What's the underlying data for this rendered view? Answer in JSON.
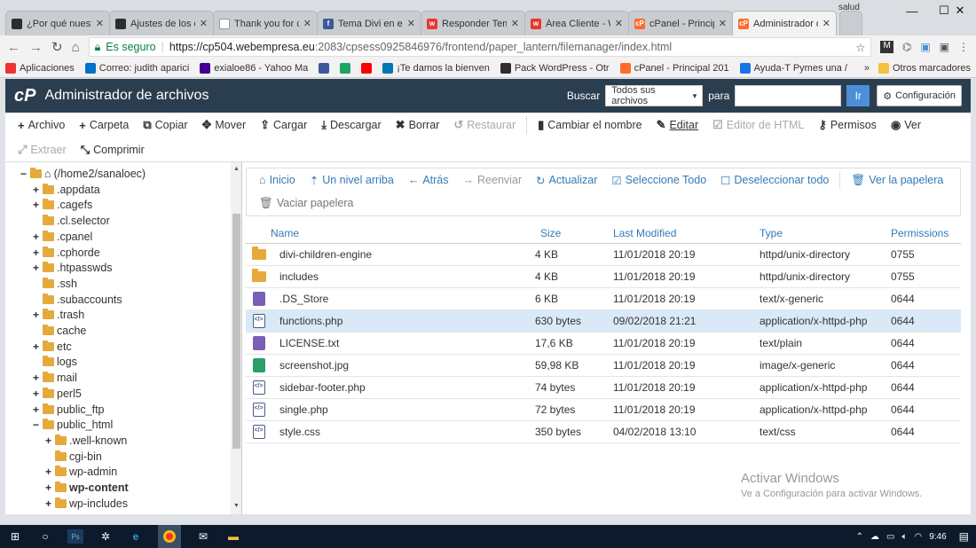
{
  "browser": {
    "profile": "salud",
    "tabs": [
      {
        "title": "¿Por qué nuestro",
        "icon_color": "#2d2d2d",
        "icon_text": ""
      },
      {
        "title": "Ajustes de los e",
        "icon_color": "#2d2d2d",
        "icon_text": ""
      },
      {
        "title": "Thank you for c",
        "icon_color": "#ffffff",
        "icon_text": ""
      },
      {
        "title": "Tema Divi en ex",
        "icon_color": "#3b5998",
        "icon_text": "f"
      },
      {
        "title": "Responder Tem",
        "icon_color": "#e8372c",
        "icon_text": "w"
      },
      {
        "title": "Área Cliente - W",
        "icon_color": "#e8372c",
        "icon_text": "w"
      },
      {
        "title": "cPanel - Princip",
        "icon_color": "#ff6c2c",
        "icon_text": "cP"
      },
      {
        "title": "Administrador d",
        "icon_color": "#ff6c2c",
        "icon_text": "cP"
      }
    ],
    "active_tab": 7,
    "url_secure_label": "Es seguro",
    "url_domain": "https://cp504.webempresa.eu",
    "url_path": ":2083/cpsess0925846976/frontend/paper_lantern/filemanager/index.html",
    "bookmarks": [
      {
        "label": "Aplicaciones",
        "color": "#e33"
      },
      {
        "label": "Correo: judith aparici",
        "color": "#0072c6"
      },
      {
        "label": "exialoe86 - Yahoo Ma",
        "color": "#410093"
      },
      {
        "label": "",
        "color": "#3b5998"
      },
      {
        "label": "",
        "color": "#1fa463"
      },
      {
        "label": "",
        "color": "#ff0000"
      },
      {
        "label": "¡Te damos la bienven",
        "color": "#0077b5"
      },
      {
        "label": "Pack WordPress - Otr",
        "color": "#2d2d2d"
      },
      {
        "label": "cPanel - Principal 201",
        "color": "#ff6c2c"
      },
      {
        "label": "Ayuda-T Pymes una /",
        "color": "#1a73e8"
      }
    ],
    "bookmarks_more": "»",
    "other_bookmarks": "Otros marcadores"
  },
  "cpanel": {
    "logo": "cP",
    "title": "Administrador de archivos",
    "search_label": "Buscar",
    "search_scope": "Todos sus archivos",
    "search_for": "para",
    "go_label": "Ir",
    "settings_label": "Configuración"
  },
  "toolbar": {
    "row1": [
      {
        "icon": "+",
        "label": "Archivo",
        "name": "new-file",
        "disabled": false
      },
      {
        "icon": "+",
        "label": "Carpeta",
        "name": "new-folder",
        "disabled": false
      },
      {
        "icon": "⧉",
        "label": "Copiar",
        "name": "copy",
        "disabled": false
      },
      {
        "icon": "✥",
        "label": "Mover",
        "name": "move",
        "disabled": false
      },
      {
        "icon": "⇪",
        "label": "Cargar",
        "name": "upload",
        "disabled": false
      },
      {
        "icon": "⤓",
        "label": "Descargar",
        "name": "download",
        "disabled": false
      },
      {
        "icon": "✖",
        "label": "Borrar",
        "name": "delete",
        "disabled": false
      },
      {
        "icon": "↺",
        "label": "Restaurar",
        "name": "restore",
        "disabled": true
      },
      {
        "icon": "▮",
        "label": "Cambiar el nombre",
        "name": "rename",
        "disabled": false
      },
      {
        "icon": "✎",
        "label": "Editar",
        "name": "edit",
        "disabled": false
      },
      {
        "icon": "☑",
        "label": "Editor de HTML",
        "name": "html-editor",
        "disabled": true
      },
      {
        "icon": "⚷",
        "label": "Permisos",
        "name": "permissions",
        "disabled": false
      },
      {
        "icon": "◉",
        "label": "Ver",
        "name": "view",
        "disabled": false
      }
    ],
    "row2": [
      {
        "icon": "⤢",
        "label": "Extraer",
        "name": "extract",
        "disabled": true
      },
      {
        "icon": "⤡",
        "label": "Comprimir",
        "name": "compress",
        "disabled": false
      }
    ]
  },
  "tree": {
    "root": "(/home2/sanaloec)",
    "items": [
      {
        "label": ".appdata",
        "tog": "+",
        "level": 1
      },
      {
        "label": ".cagefs",
        "tog": "+",
        "level": 1
      },
      {
        "label": ".cl.selector",
        "tog": "",
        "level": 1
      },
      {
        "label": ".cpanel",
        "tog": "+",
        "level": 1
      },
      {
        "label": ".cphorde",
        "tog": "+",
        "level": 1
      },
      {
        "label": ".htpasswds",
        "tog": "+",
        "level": 1
      },
      {
        "label": ".ssh",
        "tog": "",
        "level": 1
      },
      {
        "label": ".subaccounts",
        "tog": "",
        "level": 1
      },
      {
        "label": ".trash",
        "tog": "+",
        "level": 1
      },
      {
        "label": "cache",
        "tog": "",
        "level": 1
      },
      {
        "label": "etc",
        "tog": "+",
        "level": 1
      },
      {
        "label": "logs",
        "tog": "",
        "level": 1
      },
      {
        "label": "mail",
        "tog": "+",
        "level": 1
      },
      {
        "label": "perl5",
        "tog": "+",
        "level": 1
      },
      {
        "label": "public_ftp",
        "tog": "+",
        "level": 1
      },
      {
        "label": "public_html",
        "tog": "−",
        "level": 1
      },
      {
        "label": ".well-known",
        "tog": "+",
        "level": 2
      },
      {
        "label": "cgi-bin",
        "tog": "",
        "level": 2
      },
      {
        "label": "wp-admin",
        "tog": "+",
        "level": 2
      },
      {
        "label": "wp-content",
        "tog": "+",
        "level": 2,
        "bold": true
      },
      {
        "label": "wp-includes",
        "tog": "+",
        "level": 2
      }
    ]
  },
  "nav": {
    "row1": [
      {
        "icon": "⌂",
        "label": "Inicio",
        "name": "home",
        "style": "link"
      },
      {
        "icon": "⇡",
        "label": "Un nivel arriba",
        "name": "up-one-level",
        "style": "link"
      },
      {
        "icon": "←",
        "label": "Atrás",
        "name": "back",
        "style": "link"
      },
      {
        "icon": "→",
        "label": "Reenviar",
        "name": "forward",
        "style": "dis"
      },
      {
        "icon": "↻",
        "label": "Actualizar",
        "name": "refresh",
        "style": "link"
      },
      {
        "icon": "☑",
        "label": "Seleccione Todo",
        "name": "select-all",
        "style": "link"
      },
      {
        "icon": "☐",
        "label": "Deseleccionar todo",
        "name": "deselect-all",
        "style": "link"
      },
      {
        "icon": "🗑",
        "label": "Ver la papelera",
        "name": "view-trash",
        "style": "link"
      }
    ],
    "row2": [
      {
        "icon": "🗑",
        "label": "Vaciar papelera",
        "name": "empty-trash",
        "style": "gray"
      }
    ]
  },
  "table": {
    "headers": {
      "name": "Name",
      "size": "Size",
      "modified": "Last Modified",
      "type": "Type",
      "perms": "Permissions"
    },
    "rows": [
      {
        "icon": "folder",
        "name": "divi-children-engine",
        "size": "4 KB",
        "modified": "11/01/2018 20:19",
        "type": "httpd/unix-directory",
        "perms": "0755"
      },
      {
        "icon": "folder",
        "name": "includes",
        "size": "4 KB",
        "modified": "11/01/2018 20:19",
        "type": "httpd/unix-directory",
        "perms": "0755"
      },
      {
        "icon": "generic",
        "name": ".DS_Store",
        "size": "6 KB",
        "modified": "11/01/2018 20:19",
        "type": "text/x-generic",
        "perms": "0644"
      },
      {
        "icon": "code",
        "name": "functions.php",
        "size": "630 bytes",
        "modified": "09/02/2018 21:21",
        "type": "application/x-httpd-php",
        "perms": "0644",
        "selected": true
      },
      {
        "icon": "text",
        "name": "LICENSE.txt",
        "size": "17,6 KB",
        "modified": "11/01/2018 20:19",
        "type": "text/plain",
        "perms": "0644"
      },
      {
        "icon": "image",
        "name": "screenshot.jpg",
        "size": "59,98 KB",
        "modified": "11/01/2018 20:19",
        "type": "image/x-generic",
        "perms": "0644"
      },
      {
        "icon": "code",
        "name": "sidebar-footer.php",
        "size": "74 bytes",
        "modified": "11/01/2018 20:19",
        "type": "application/x-httpd-php",
        "perms": "0644"
      },
      {
        "icon": "code",
        "name": "single.php",
        "size": "72 bytes",
        "modified": "11/01/2018 20:19",
        "type": "application/x-httpd-php",
        "perms": "0644"
      },
      {
        "icon": "code",
        "name": "style.css",
        "size": "350 bytes",
        "modified": "04/02/2018 13:10",
        "type": "text/css",
        "perms": "0644"
      }
    ]
  },
  "watermark": {
    "line1": "Activar Windows",
    "line2": "Ve a Configuración para activar Windows."
  },
  "taskbar": {
    "time": "9:46"
  }
}
